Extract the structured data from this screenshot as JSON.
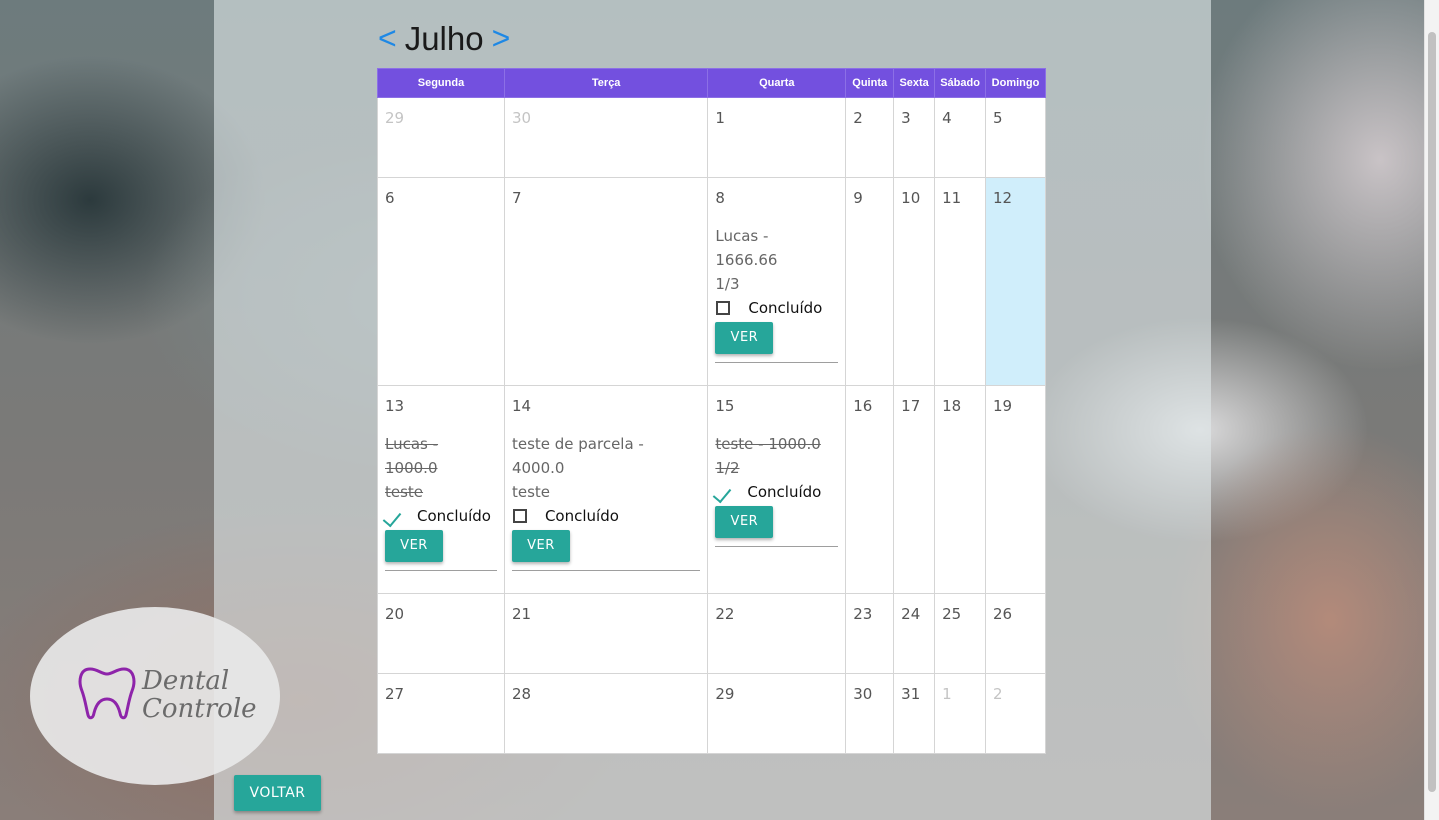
{
  "month": {
    "prev": "<",
    "title": "Julho",
    "next": ">"
  },
  "weekdays": [
    "Segunda",
    "Terça",
    "Quarta",
    "Quinta",
    "Sexta",
    "Sábado",
    "Domingo"
  ],
  "weeks": [
    {
      "days": [
        "29",
        "30",
        "1",
        "2",
        "3",
        "4",
        "5"
      ]
    },
    {
      "days": [
        "6",
        "7",
        "8",
        "9",
        "10",
        "11",
        "12"
      ]
    },
    {
      "days": [
        "13",
        "14",
        "15",
        "16",
        "17",
        "18",
        "19"
      ]
    },
    {
      "days": [
        "20",
        "21",
        "22",
        "23",
        "24",
        "25",
        "26"
      ]
    },
    {
      "days": [
        "27",
        "28",
        "29",
        "30",
        "31",
        "1",
        "2"
      ]
    }
  ],
  "events": {
    "jul8": {
      "line1": "Lucas -",
      "line2": "1666.66",
      "line3": "1/3",
      "done": false
    },
    "jul13": {
      "line1": "Lucas -",
      "line2": "1000.0",
      "line3": "teste",
      "done": true
    },
    "jul14": {
      "line1": "teste de parcela -",
      "line2": "4000.0",
      "line3": "teste",
      "done": false
    },
    "jul15": {
      "line1": "teste - 1000.0",
      "line2": "1/2",
      "done": true
    }
  },
  "labels": {
    "concluido": "Concluído",
    "ver": "VER",
    "voltar": "VOLTAR"
  },
  "logo": {
    "line1": "Dental",
    "line2": "Controle"
  },
  "colors": {
    "header": "#7350df",
    "accent": "#26a69a",
    "today": "#d0eefb",
    "nav_arrow": "#1e88e5"
  }
}
